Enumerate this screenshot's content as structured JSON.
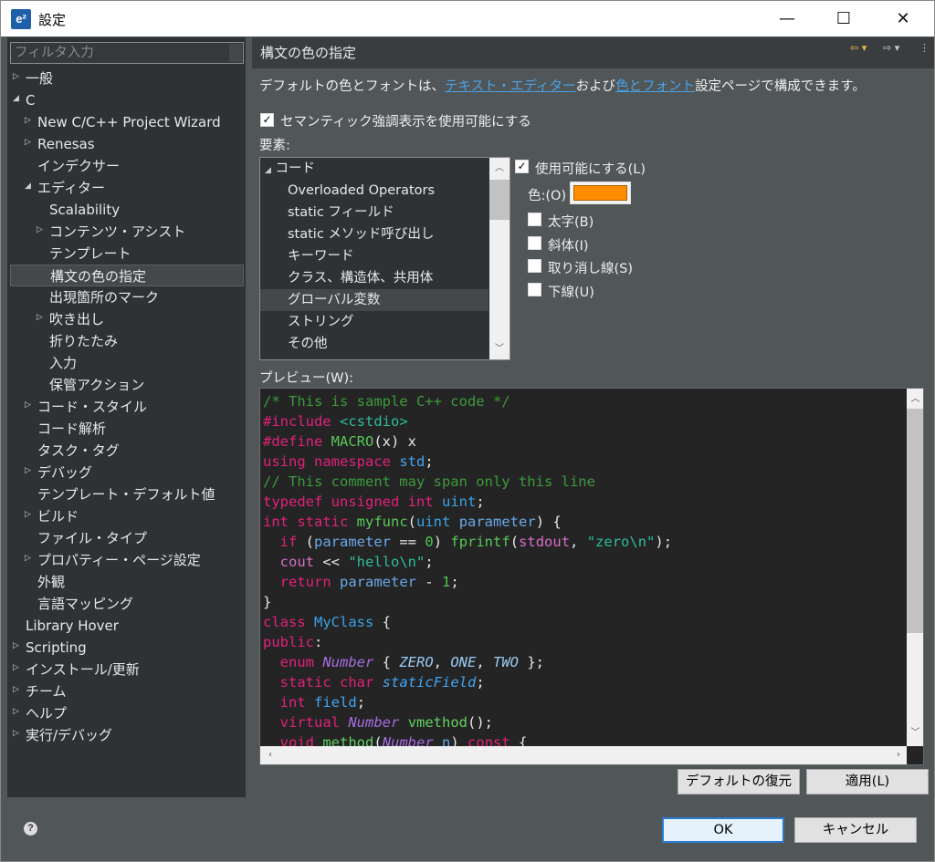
{
  "window": {
    "title": "設定",
    "icon_text": "e²",
    "minimize": "—",
    "maximize": "☐",
    "close": "✕"
  },
  "filter": {
    "placeholder": "フィルタ入力"
  },
  "tree": [
    {
      "label": "一般",
      "level": 0,
      "arrow": "right"
    },
    {
      "label": "C",
      "level": 0,
      "arrow": "down"
    },
    {
      "label": "New C/C++ Project Wizard",
      "level": 1,
      "arrow": "right"
    },
    {
      "label": "Renesas",
      "level": 1,
      "arrow": "right"
    },
    {
      "label": "インデクサー",
      "level": 1,
      "arrow": "none"
    },
    {
      "label": "エディター",
      "level": 1,
      "arrow": "down"
    },
    {
      "label": "Scalability",
      "level": 2,
      "arrow": "none"
    },
    {
      "label": "コンテンツ・アシスト",
      "level": 2,
      "arrow": "right"
    },
    {
      "label": "テンプレート",
      "level": 2,
      "arrow": "none"
    },
    {
      "label": "構文の色の指定",
      "level": 2,
      "arrow": "none",
      "selected": true
    },
    {
      "label": "出現箇所のマーク",
      "level": 2,
      "arrow": "none"
    },
    {
      "label": "吹き出し",
      "level": 2,
      "arrow": "right"
    },
    {
      "label": "折りたたみ",
      "level": 2,
      "arrow": "none"
    },
    {
      "label": "入力",
      "level": 2,
      "arrow": "none"
    },
    {
      "label": "保管アクション",
      "level": 2,
      "arrow": "none"
    },
    {
      "label": "コード・スタイル",
      "level": 1,
      "arrow": "right"
    },
    {
      "label": "コード解析",
      "level": 1,
      "arrow": "none"
    },
    {
      "label": "タスク・タグ",
      "level": 1,
      "arrow": "none"
    },
    {
      "label": "デバッグ",
      "level": 1,
      "arrow": "right"
    },
    {
      "label": "テンプレート・デフォルト値",
      "level": 1,
      "arrow": "none"
    },
    {
      "label": "ビルド",
      "level": 1,
      "arrow": "right"
    },
    {
      "label": "ファイル・タイプ",
      "level": 1,
      "arrow": "none"
    },
    {
      "label": "プロパティー・ページ設定",
      "level": 1,
      "arrow": "right"
    },
    {
      "label": "外観",
      "level": 1,
      "arrow": "none"
    },
    {
      "label": "言語マッピング",
      "level": 1,
      "arrow": "none"
    },
    {
      "label": "Library Hover",
      "level": 0,
      "arrow": "none"
    },
    {
      "label": "Scripting",
      "level": 0,
      "arrow": "right"
    },
    {
      "label": "インストール/更新",
      "level": 0,
      "arrow": "right"
    },
    {
      "label": "チーム",
      "level": 0,
      "arrow": "right"
    },
    {
      "label": "ヘルプ",
      "level": 0,
      "arrow": "right"
    },
    {
      "label": "実行/デバッグ",
      "level": 0,
      "arrow": "right"
    }
  ],
  "page": {
    "title": "構文の色の指定",
    "desc_before": "デフォルトの色とフォントは、",
    "desc_link1": "テキスト・エディター",
    "desc_middle": "および",
    "desc_link2": "色とフォント",
    "desc_after": "設定ページで構成できます。",
    "semantic_label": "セマンティック強調表示を使用可能にする",
    "semantic_checked": true,
    "elements_label": "要素:",
    "preview_label": "プレビュー(W):"
  },
  "elements": {
    "category": "コード",
    "items": [
      "Overloaded Operators",
      "static フィールド",
      "static メソッド呼び出し",
      "キーワード",
      "クラス、構造体、共用体",
      "グローバル変数",
      "ストリング",
      "その他"
    ],
    "selected": "グローバル変数"
  },
  "options": {
    "enable": {
      "label": "使用可能にする(L)",
      "checked": true
    },
    "color_label": "色:(O)",
    "color": "#ff8c00",
    "bold": {
      "label": "太字(B)",
      "checked": false
    },
    "italic": {
      "label": "斜体(I)",
      "checked": false
    },
    "strike": {
      "label": "取り消し線(S)",
      "checked": false
    },
    "underline": {
      "label": "下線(U)",
      "checked": false
    }
  },
  "code_lines": [
    "/* This is sample C++ code */",
    "#include <cstdio>",
    "#define MACRO(x) x",
    "using namespace std;",
    "// This comment may span only this line",
    "typedef unsigned int uint;",
    "int static myfunc(uint parameter) {",
    "  if (parameter == 0) fprintf(stdout, \"zero\\n\");",
    "  cout << \"hello\\n\";",
    "  return parameter - 1;",
    "}",
    "class MyClass {",
    "public:",
    "  enum Number { ZERO, ONE, TWO };",
    "  static char staticField;",
    "  int field;",
    "  virtual Number vmethod();",
    "  void method(Number n) const {"
  ],
  "buttons": {
    "restore_defaults": "デフォルトの復元(T)",
    "apply": "適用(L)",
    "ok": "OK",
    "cancel": "キャンセル"
  },
  "colors": {
    "window_bg": "#515658",
    "panel_bg": "#2f3235",
    "link": "#4aa3e8",
    "accent": "#ff8c00"
  }
}
